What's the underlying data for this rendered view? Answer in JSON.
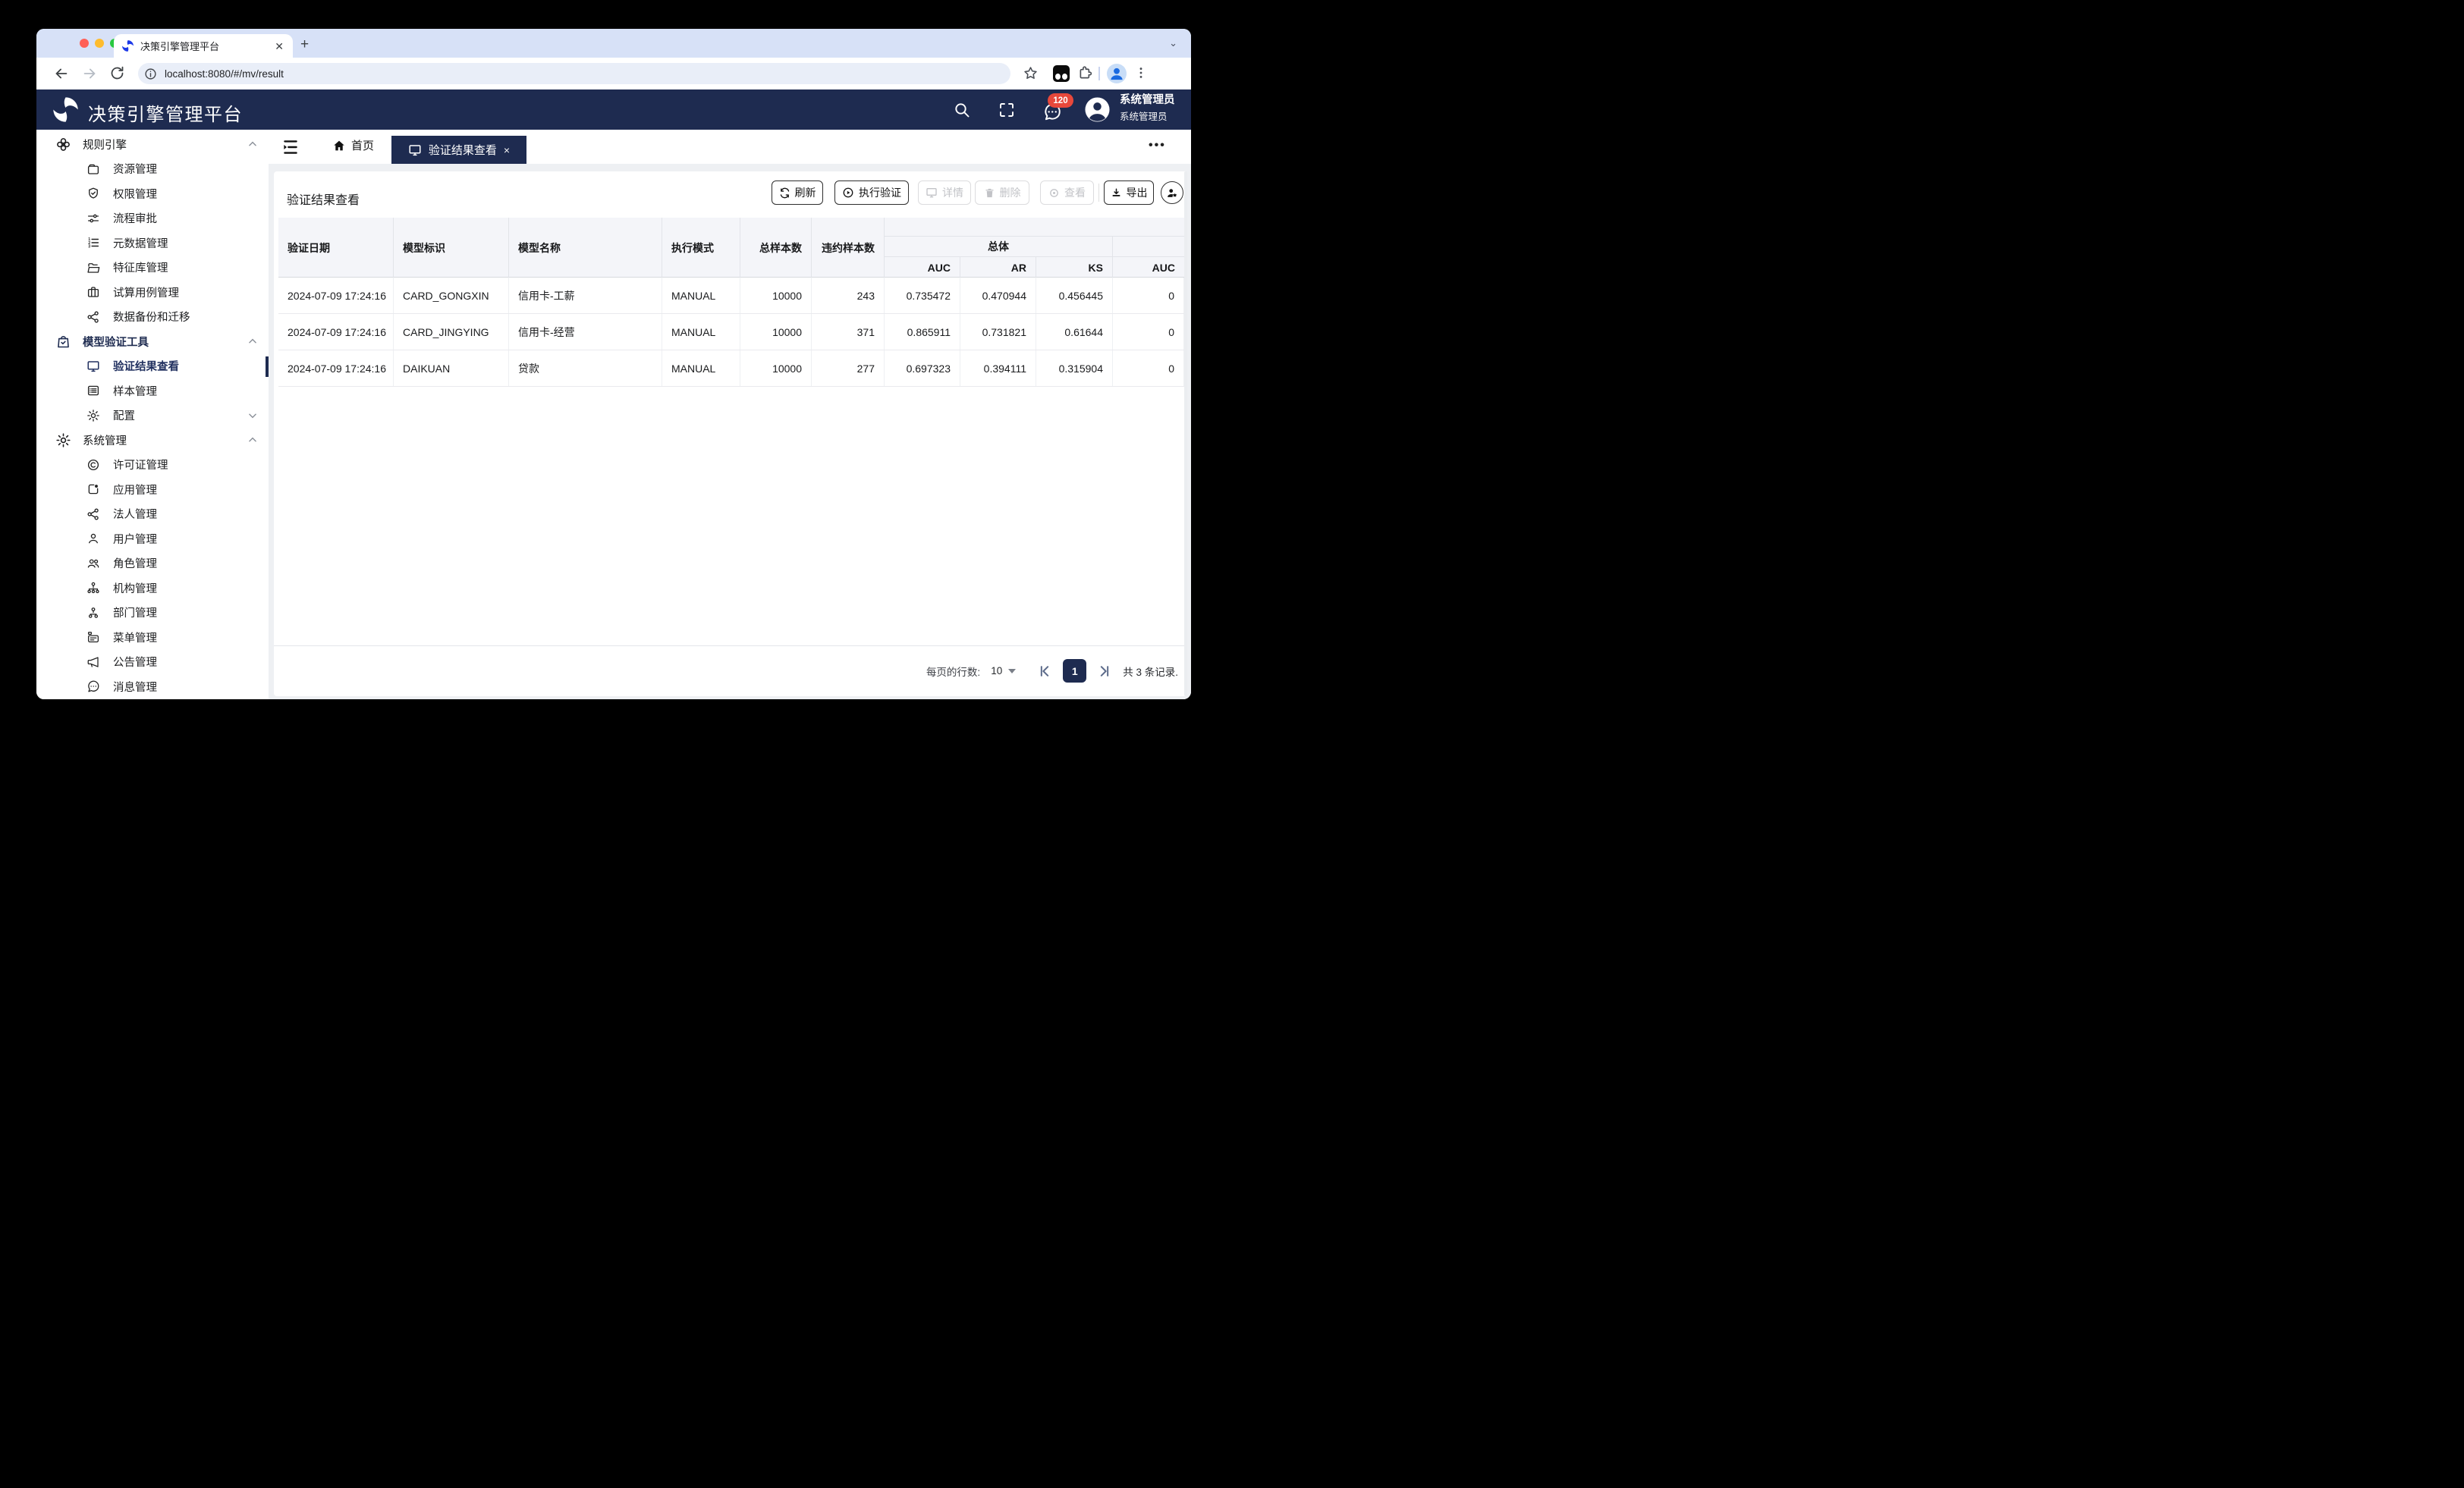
{
  "browser": {
    "tab_title": "决策引擎管理平台",
    "new_tab_label": "+",
    "url": "localhost:8080/#/mv/result"
  },
  "app_header": {
    "title": "决策引擎管理平台",
    "message_badge": "120",
    "user_name": "系统管理员",
    "user_role": "系统管理员"
  },
  "sidebar": {
    "groups": [
      {
        "label": "规则引擎",
        "items": [
          {
            "label": "资源管理"
          },
          {
            "label": "权限管理"
          },
          {
            "label": "流程审批"
          },
          {
            "label": "元数据管理"
          },
          {
            "label": "特征库管理"
          },
          {
            "label": "试算用例管理"
          },
          {
            "label": "数据备份和迁移"
          }
        ]
      },
      {
        "label": "模型验证工具",
        "items": [
          {
            "label": "验证结果查看"
          },
          {
            "label": "样本管理"
          },
          {
            "label": "配置"
          }
        ]
      },
      {
        "label": "系统管理",
        "items": [
          {
            "label": "许可证管理"
          },
          {
            "label": "应用管理"
          },
          {
            "label": "法人管理"
          },
          {
            "label": "用户管理"
          },
          {
            "label": "角色管理"
          },
          {
            "label": "机构管理"
          },
          {
            "label": "部门管理"
          },
          {
            "label": "菜单管理"
          },
          {
            "label": "公告管理"
          },
          {
            "label": "消息管理"
          }
        ]
      }
    ]
  },
  "tabbar": {
    "home_label": "首页",
    "active_tab": "验证结果查看",
    "close_label": "×",
    "more_label": "•••"
  },
  "page": {
    "title": "验证结果查看"
  },
  "toolbar": {
    "refresh": "刷新",
    "execute": "执行验证",
    "detail": "详情",
    "delete": "删除",
    "view": "查看",
    "export": "导出"
  },
  "table": {
    "headers": {
      "date": "验证日期",
      "model_id": "模型标识",
      "model_name": "模型名称",
      "mode": "执行模式",
      "total_samples": "总样本数",
      "default_samples": "违约样本数",
      "group_overall": "总体",
      "auc": "AUC",
      "ar": "AR",
      "ks": "KS",
      "auc2": "AUC"
    },
    "rows": [
      {
        "date": "2024-07-09 17:24:16",
        "model_id": "CARD_GONGXIN",
        "model_name": "信用卡-工薪",
        "mode": "MANUAL",
        "total": "10000",
        "defaults": "243",
        "auc": "0.735472",
        "ar": "0.470944",
        "ks": "0.456445",
        "auc2": "0"
      },
      {
        "date": "2024-07-09 17:24:16",
        "model_id": "CARD_JINGYING",
        "model_name": "信用卡-经营",
        "mode": "MANUAL",
        "total": "10000",
        "defaults": "371",
        "auc": "0.865911",
        "ar": "0.731821",
        "ks": "0.61644",
        "auc2": "0"
      },
      {
        "date": "2024-07-09 17:24:16",
        "model_id": "DAIKUAN",
        "model_name": "贷款",
        "mode": "MANUAL",
        "total": "10000",
        "defaults": "277",
        "auc": "0.697323",
        "ar": "0.394111",
        "ks": "0.315904",
        "auc2": "0"
      }
    ]
  },
  "pagination": {
    "rows_per_page_label": "每页的行数:",
    "rows_per_page": "10",
    "current_page": "1",
    "total_label": "共 3 条记录."
  },
  "colors": {
    "navy": "#1e2b50",
    "badge_red": "#e8483b",
    "tabstrip_blue": "#d7e1f7"
  }
}
